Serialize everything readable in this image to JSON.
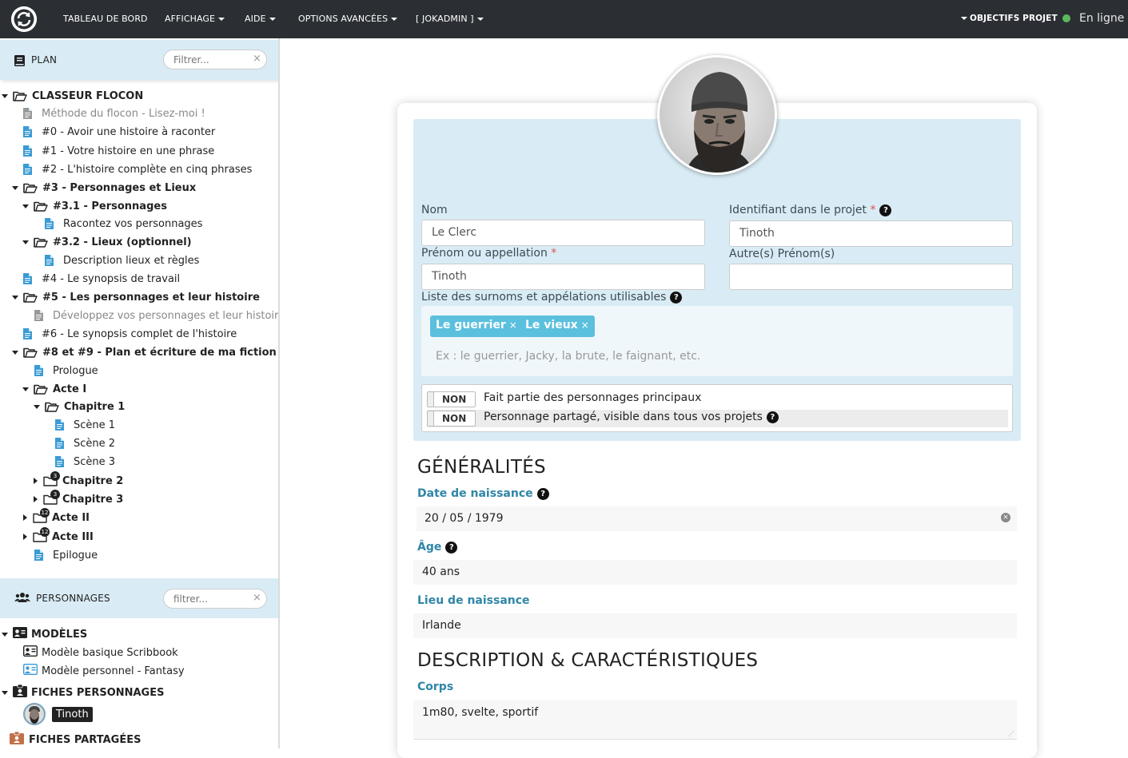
{
  "navbar": {
    "menu": [
      "TABLEAU DE BORD",
      "AFFICHAGE",
      "AIDE",
      "OPTIONS AVANCÉES",
      "[ JOKADMIN ]"
    ],
    "objectives": "OBJECTIFS PROJET",
    "status": "En ligne",
    "status_color": "#5cb85c"
  },
  "plan": {
    "title": "PLAN",
    "filter_placeholder": "Filtrer...",
    "tree": [
      "CLASSEUR FLOCON",
      "Méthode du flocon - Lisez-moi !",
      "#0 - Avoir une histoire à raconter",
      "#1 - Votre histoire en une phrase",
      "#2 - L'histoire complète en cinq phrases",
      "#3 - Personnages et Lieux",
      "#3.1 - Personnages",
      "Racontez vos personnages",
      "#3.2 - Lieux (optionnel)",
      "Description lieux et règles",
      "#4 - Le synopsis de travail",
      "#5 - Les personnages et leur histoire",
      "Développez vos personnages et leur histoire",
      "#6 - Le synopsis complet de l'histoire",
      "#8 et #9 - Plan et écriture de ma fiction",
      "Prologue",
      "Acte I",
      "Chapitre 1",
      "Scène 1",
      "Scène 2",
      "Scène 3",
      "Chapitre 2",
      "Chapitre 3",
      "Acte II",
      "Acte III",
      "Epilogue"
    ],
    "badges": [
      "3",
      "3",
      "12",
      "12"
    ]
  },
  "characters": {
    "title": "PERSONNAGES",
    "filter_placeholder": "filtrer...",
    "tree": [
      "MODÈLES",
      "Modèle basique Scribbook",
      "Modèle personnel - Fantasy",
      "FICHES PERSONNAGES",
      "Tinoth",
      "FICHES PARTAGÉES"
    ]
  },
  "form": {
    "nom_label": "Nom",
    "nom_value": "Le Clerc",
    "identifiant_label": "Identifiant dans le projet",
    "identifiant_value": "Tinoth",
    "prenom_label": "Prénom ou appellation",
    "prenom_value": "Tinoth",
    "autres_label": "Autre(s) Prénom(s)",
    "autres_value": "",
    "surnoms_label": "Liste des surnoms et appélations utilisables",
    "tags": [
      "Le guerrier",
      "Le vieux"
    ],
    "tags_placeholder": "Ex : le guerrier, Jacky, la brute, le faignant, etc.",
    "toggle_off": "NON",
    "toggle1_label": "Fait partie des personnages principaux",
    "toggle2_label": "Personnage partagé, visible dans tous vos projets",
    "required_mark": "*",
    "help_mark": "?"
  },
  "generalites": {
    "title": "GÉNÉRALITÉS",
    "date_label": "Date de naissance",
    "date_value": "20 / 05 / 1979",
    "age_label": "Âge",
    "age_value": "40 ans",
    "lieu_label": "Lieu de naissance",
    "lieu_value": "Irlande"
  },
  "description": {
    "title": "DESCRIPTION & CARACTÉRISTIQUES",
    "corps_label": "Corps",
    "corps_value": "1m80, svelte, sportif"
  },
  "colors": {
    "navbar": "#2b2f33",
    "panel": "#d9ecf5",
    "tag": "#5bc0de",
    "field_label": "#2f86a6",
    "doc_icon": "#3a9bd5"
  }
}
